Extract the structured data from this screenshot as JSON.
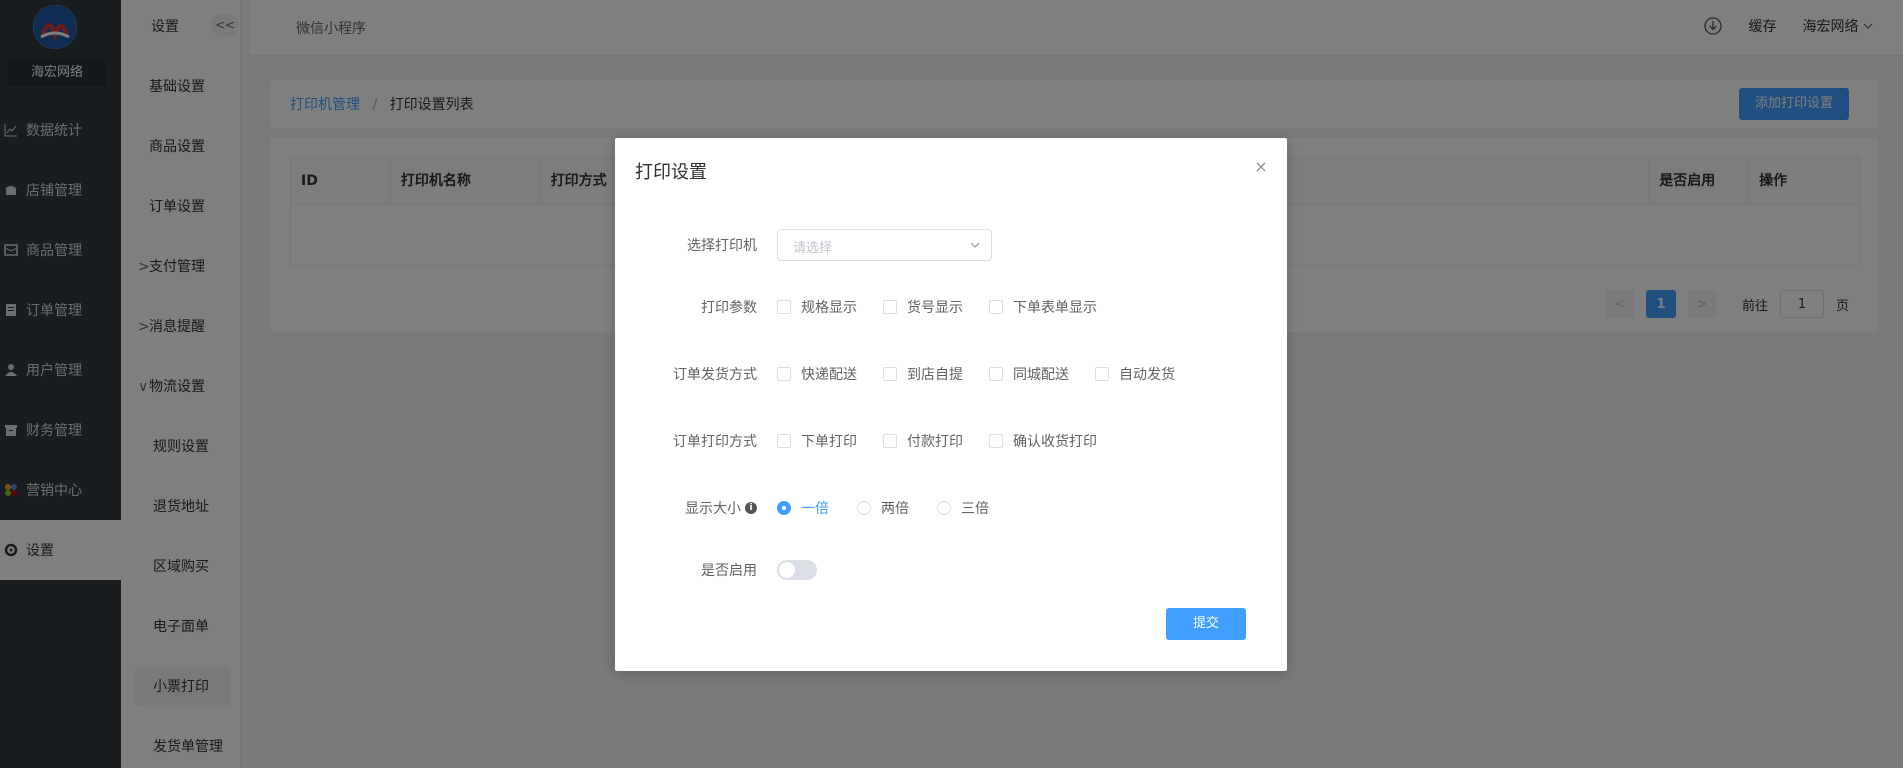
{
  "app": {
    "brand": "海宏网络",
    "top_crumb": "微信小程序",
    "top_right": {
      "cache_label": "缓存",
      "user_label": "海宏网络"
    }
  },
  "sidebar": {
    "items": [
      {
        "label": "数据统计",
        "icon": "chart-line-icon"
      },
      {
        "label": "店铺管理",
        "icon": "store-icon"
      },
      {
        "label": "商品管理",
        "icon": "box-icon"
      },
      {
        "label": "订单管理",
        "icon": "clipboard-icon"
      },
      {
        "label": "用户管理",
        "icon": "user-icon"
      },
      {
        "label": "财务管理",
        "icon": "archive-icon"
      },
      {
        "label": "营销中心",
        "icon": "colorful-dots-icon"
      },
      {
        "label": "设置",
        "icon": "gear-icon"
      }
    ]
  },
  "subbar": {
    "title": "设置",
    "collapse_label": "<<",
    "items": [
      {
        "label": "基础设置"
      },
      {
        "label": "商品设置"
      },
      {
        "label": "订单设置"
      },
      {
        "label": "支付管理",
        "chevron": ">"
      },
      {
        "label": "消息提醒",
        "chevron": ">"
      },
      {
        "label": "物流设置",
        "chevron": "∨"
      }
    ],
    "children": [
      {
        "label": "规则设置"
      },
      {
        "label": "退货地址"
      },
      {
        "label": "区域购买"
      },
      {
        "label": "电子面单"
      },
      {
        "label": "小票打印"
      },
      {
        "label": "发货单管理"
      }
    ]
  },
  "page": {
    "breadcrumb": {
      "parent": "打印机管理",
      "separator": "/",
      "current": "打印设置列表"
    },
    "add_button": "添加打印设置",
    "table": {
      "columns": [
        "ID",
        "打印机名称",
        "打印方式",
        "",
        "是否启用",
        "操作"
      ]
    },
    "pager": {
      "prev": "<",
      "page": "1",
      "next": ">",
      "goto_prefix": "前往",
      "goto_value": "1",
      "goto_suffix": "页"
    }
  },
  "modal": {
    "title": "打印设置",
    "close": "×",
    "rows": {
      "printer": {
        "label": "选择打印机",
        "placeholder": "请选择"
      },
      "params": {
        "label": "打印参数",
        "options": [
          "规格显示",
          "货号显示",
          "下单表单显示"
        ]
      },
      "delivery": {
        "label": "订单发货方式",
        "options": [
          "快递配送",
          "到店自提",
          "同城配送",
          "自动发货"
        ]
      },
      "print_mode": {
        "label": "订单打印方式",
        "options": [
          "下单打印",
          "付款打印",
          "确认收货打印"
        ]
      },
      "size": {
        "label": "显示大小",
        "info": "i",
        "options": [
          "一倍",
          "两倍",
          "三倍"
        ],
        "selected": "一倍"
      },
      "enabled": {
        "label": "是否启用",
        "value": "off"
      }
    },
    "submit": "提交"
  },
  "colors": {
    "primary": "#409eff",
    "sidebar": "#333a41"
  }
}
